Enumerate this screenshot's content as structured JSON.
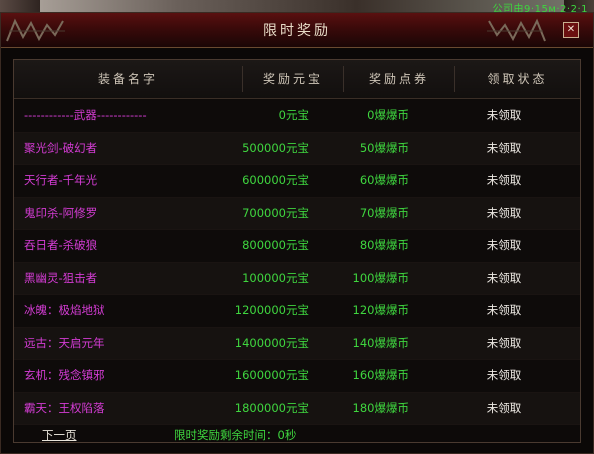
{
  "topright": "公司由9·15ᴍ·2·2·1",
  "window": {
    "title": "限时奖励",
    "close_glyph": "✕"
  },
  "headers": [
    "装备名字",
    "奖励元宝",
    "奖励点券",
    "领取状态"
  ],
  "rows": [
    {
      "name": "------------武器------------",
      "gold": "0元宝",
      "points": "0爆爆币",
      "status": "未领取"
    },
    {
      "name": "聚光剑-破幻者",
      "gold": "500000元宝",
      "points": "50爆爆币",
      "status": "未领取"
    },
    {
      "name": "天行者-千年光",
      "gold": "600000元宝",
      "points": "60爆爆币",
      "status": "未领取"
    },
    {
      "name": "鬼印杀-阿修罗",
      "gold": "700000元宝",
      "points": "70爆爆币",
      "status": "未领取"
    },
    {
      "name": "吞日者-杀破狼",
      "gold": "800000元宝",
      "points": "80爆爆币",
      "status": "未领取"
    },
    {
      "name": "黑幽灵-狙击者",
      "gold": "100000元宝",
      "points": "100爆爆币",
      "status": "未领取"
    },
    {
      "name": "冰魄：极焰地狱",
      "gold": "1200000元宝",
      "points": "120爆爆币",
      "status": "未领取"
    },
    {
      "name": "远古：天启元年",
      "gold": "1400000元宝",
      "points": "140爆爆币",
      "status": "未领取"
    },
    {
      "name": "玄机：残念镇邪",
      "gold": "1600000元宝",
      "points": "160爆爆币",
      "status": "未领取"
    },
    {
      "name": "霸天：王权陷落",
      "gold": "1800000元宝",
      "points": "180爆爆币",
      "status": "未领取"
    }
  ],
  "footer": {
    "next_page": "下一页",
    "timer": "限时奖励剩余时间：0秒"
  },
  "colors": {
    "name": "#d43cd4",
    "reward": "#3fd63f",
    "status": "#f0ece6",
    "title_bar": "#5a1010"
  }
}
